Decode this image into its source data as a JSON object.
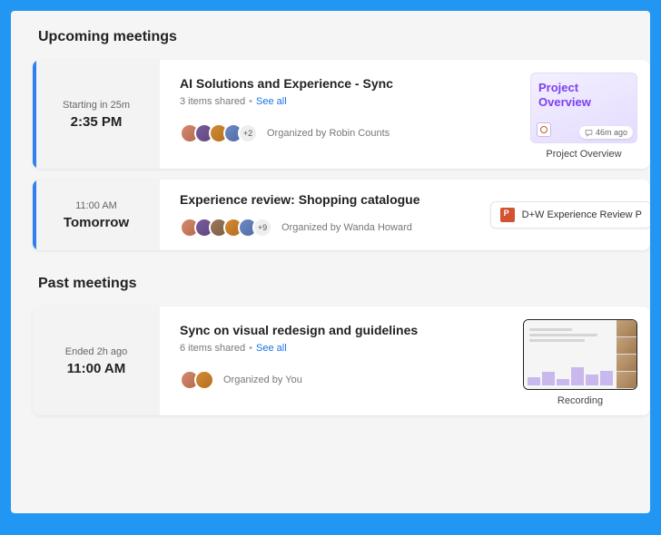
{
  "sections": {
    "upcoming_title": "Upcoming meetings",
    "past_title": "Past meetings"
  },
  "upcoming": [
    {
      "time_sub": "Starting in 25m",
      "time_main": "2:35 PM",
      "title": "AI Solutions and Experience - Sync",
      "shared_text": "3 items shared",
      "see_all": "See all",
      "overflow": "+2",
      "organizer": "Organized by Robin Counts",
      "tile_line1": "Project",
      "tile_line2": "Overview",
      "tile_badge": "46m ago",
      "tile_caption": "Project Overview"
    },
    {
      "time_sub": "11:00 AM",
      "time_main": "Tomorrow",
      "title": "Experience review: Shopping catalogue",
      "overflow": "+9",
      "organizer": "Organized by Wanda Howard",
      "file_label": "D+W Experience Review P"
    }
  ],
  "past": [
    {
      "time_sub": "Ended 2h ago",
      "time_main": "11:00 AM",
      "title": "Sync on visual redesign and guidelines",
      "shared_text": "6 items shared",
      "see_all": "See all",
      "organizer": "Organized by You",
      "tile_caption": "Recording"
    }
  ]
}
